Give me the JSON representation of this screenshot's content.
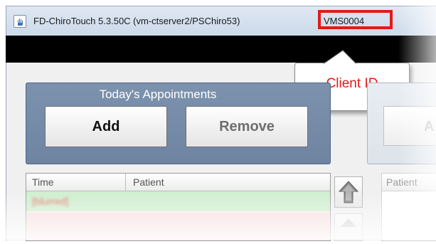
{
  "window": {
    "title": "FD-ChiroTouch 5.3.50C (vm-ctserver2/PSChiro53)",
    "client_id": "VMS0004"
  },
  "callout": {
    "label": "Client ID",
    "color": "#e01b1b"
  },
  "appointments": {
    "title": "Today's Appointments",
    "add_label": "Add",
    "remove_label": "Remove"
  },
  "grid": {
    "columns": [
      "Time",
      "Patient"
    ],
    "rows": [
      {
        "text": "[blurred]"
      }
    ]
  },
  "right_panel": {
    "button_label": "A",
    "grid_header": "Patient"
  },
  "icons": {
    "app": "chirotouch-hand-icon",
    "scroll_up": "arrow-up-icon",
    "scroll_down": "arrow-down-icon"
  }
}
